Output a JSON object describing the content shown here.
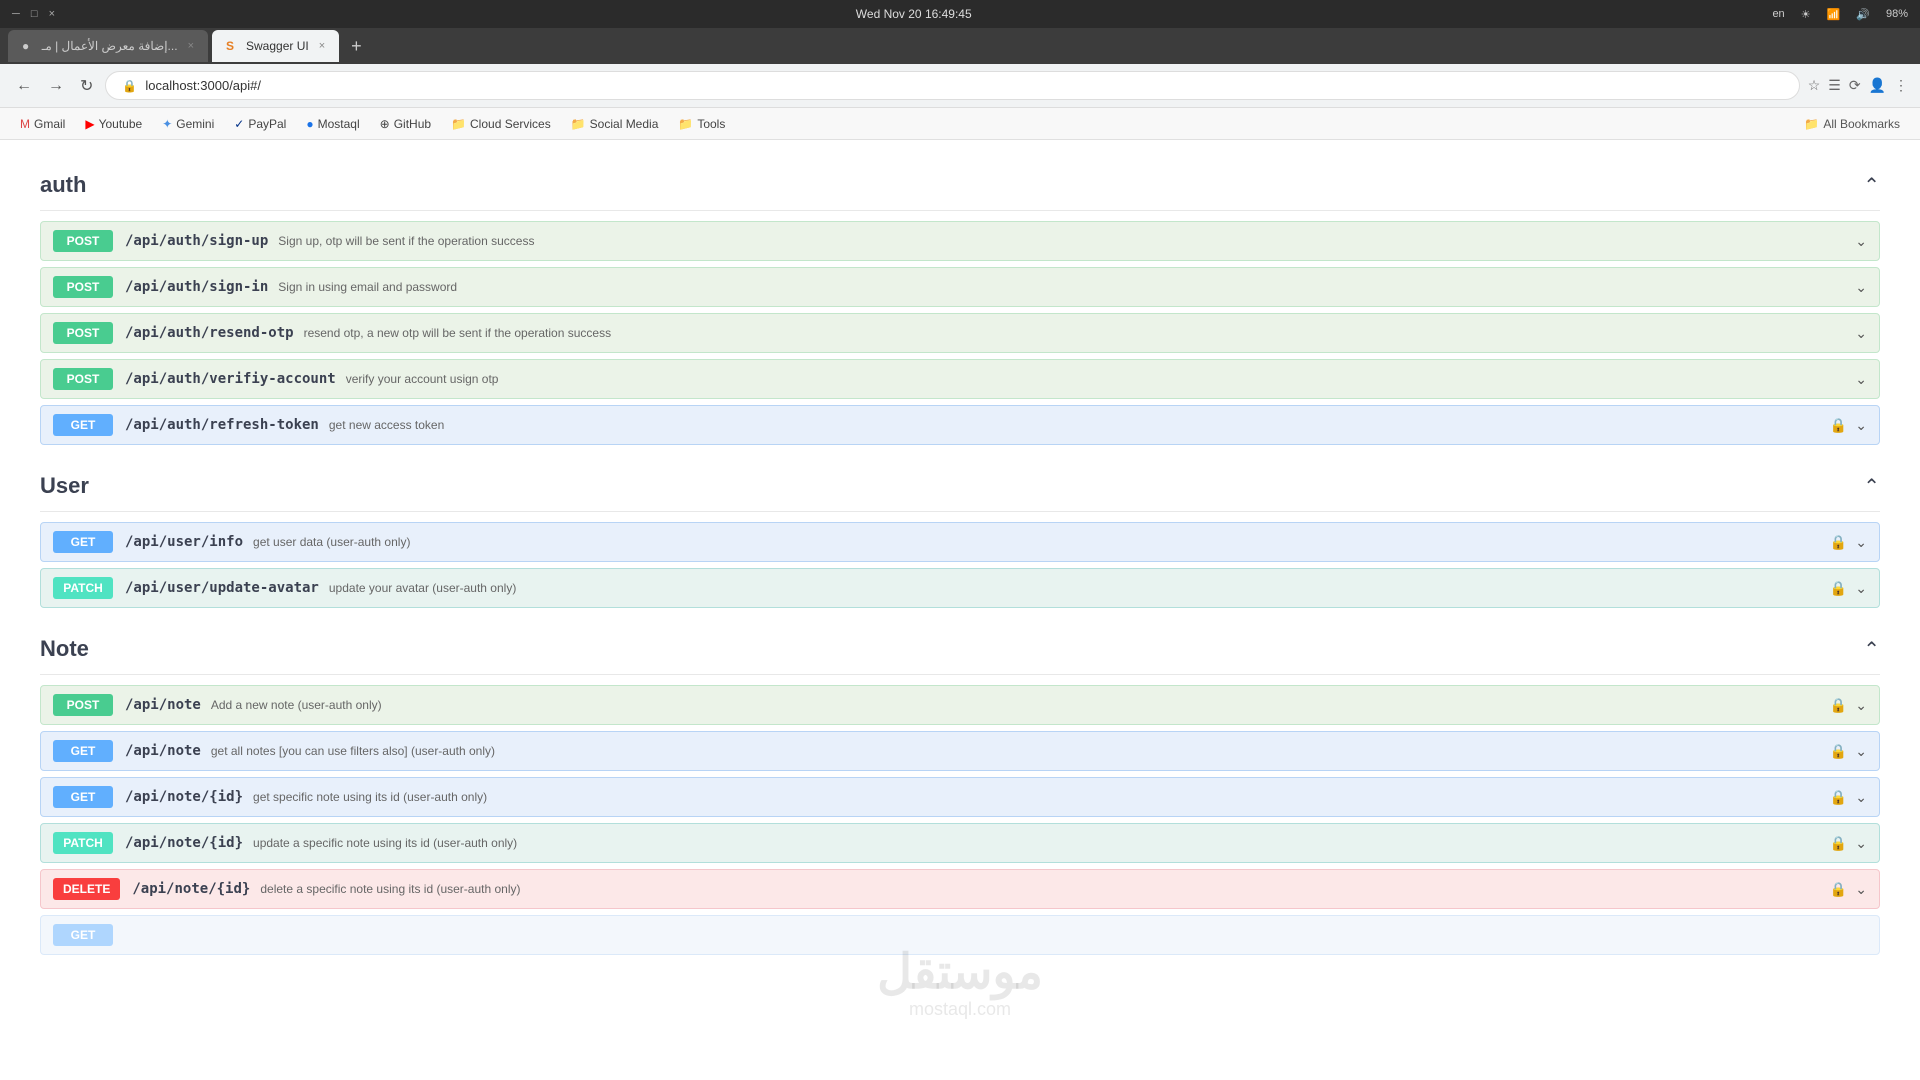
{
  "browser": {
    "titlebar": {
      "datetime": "Wed Nov 20  16:49:45",
      "lang": "en",
      "battery": "98%"
    },
    "tabs": [
      {
        "id": "tab1",
        "label": "إضافة معرض الأعمال | مـ...",
        "active": false,
        "favicon": "●"
      },
      {
        "id": "tab2",
        "label": "Swagger UI",
        "active": true,
        "favicon": "S"
      }
    ],
    "addressbar": {
      "url": "localhost:3000/api#/"
    },
    "bookmarks": [
      {
        "id": "gmail",
        "label": "Gmail",
        "icon": "✉"
      },
      {
        "id": "youtube",
        "label": "Youtube",
        "icon": "▶"
      },
      {
        "id": "gemini",
        "label": "Gemini",
        "icon": "✦"
      },
      {
        "id": "paypal",
        "label": "PayPal",
        "icon": "P"
      },
      {
        "id": "mostaql",
        "label": "Mostaql",
        "icon": "●"
      },
      {
        "id": "github",
        "label": "GitHub",
        "icon": "⊕"
      },
      {
        "id": "cloud-services",
        "label": "Cloud Services",
        "icon": "📁"
      },
      {
        "id": "social-media",
        "label": "Social Media",
        "icon": "📁"
      },
      {
        "id": "tools",
        "label": "Tools",
        "icon": "📁"
      }
    ],
    "all_bookmarks_label": "All Bookmarks"
  },
  "swagger": {
    "sections": [
      {
        "id": "auth",
        "title": "auth",
        "endpoints": [
          {
            "id": "sign-up",
            "method": "POST",
            "path": "/api/auth/sign-up",
            "desc": "Sign up, otp will be sent if the operation success",
            "auth": false
          },
          {
            "id": "sign-in",
            "method": "POST",
            "path": "/api/auth/sign-in",
            "desc": "Sign in using email and password",
            "auth": false
          },
          {
            "id": "resend-otp",
            "method": "POST",
            "path": "/api/auth/resend-otp",
            "desc": "resend otp, a new otp will be sent if the operation success",
            "auth": false
          },
          {
            "id": "verifiy-account",
            "method": "POST",
            "path": "/api/auth/verifiy-account",
            "desc": "verify your account usign otp",
            "auth": false
          },
          {
            "id": "refresh-token",
            "method": "GET",
            "path": "/api/auth/refresh-token",
            "desc": "get new access token",
            "auth": true
          }
        ]
      },
      {
        "id": "user",
        "title": "User",
        "endpoints": [
          {
            "id": "user-info",
            "method": "GET",
            "path": "/api/user/info",
            "desc": "get user data (user-auth only)",
            "auth": true
          },
          {
            "id": "user-update-avatar",
            "method": "PATCH",
            "path": "/api/user/update-avatar",
            "desc": "update your avatar (user-auth only)",
            "auth": true
          }
        ]
      },
      {
        "id": "note",
        "title": "Note",
        "endpoints": [
          {
            "id": "note-post",
            "method": "POST",
            "path": "/api/note",
            "desc": "Add a new note (user-auth only)",
            "auth": true
          },
          {
            "id": "note-get-all",
            "method": "GET",
            "path": "/api/note",
            "desc": "get all notes [you can use filters also] (user-auth only)",
            "auth": true
          },
          {
            "id": "note-get-id",
            "method": "GET",
            "path": "/api/note/{id}",
            "desc": "get specific note using its id (user-auth only)",
            "auth": true
          },
          {
            "id": "note-patch-id",
            "method": "PATCH",
            "path": "/api/note/{id}",
            "desc": "update a specific note using its id (user-auth only)",
            "auth": true
          },
          {
            "id": "note-delete-id",
            "method": "DELETE",
            "path": "/api/note/{id}",
            "desc": "delete a specific note using its id (user-auth only)",
            "auth": true
          }
        ]
      }
    ],
    "watermark": "موستقل",
    "watermark_url": "mostaql.com"
  }
}
